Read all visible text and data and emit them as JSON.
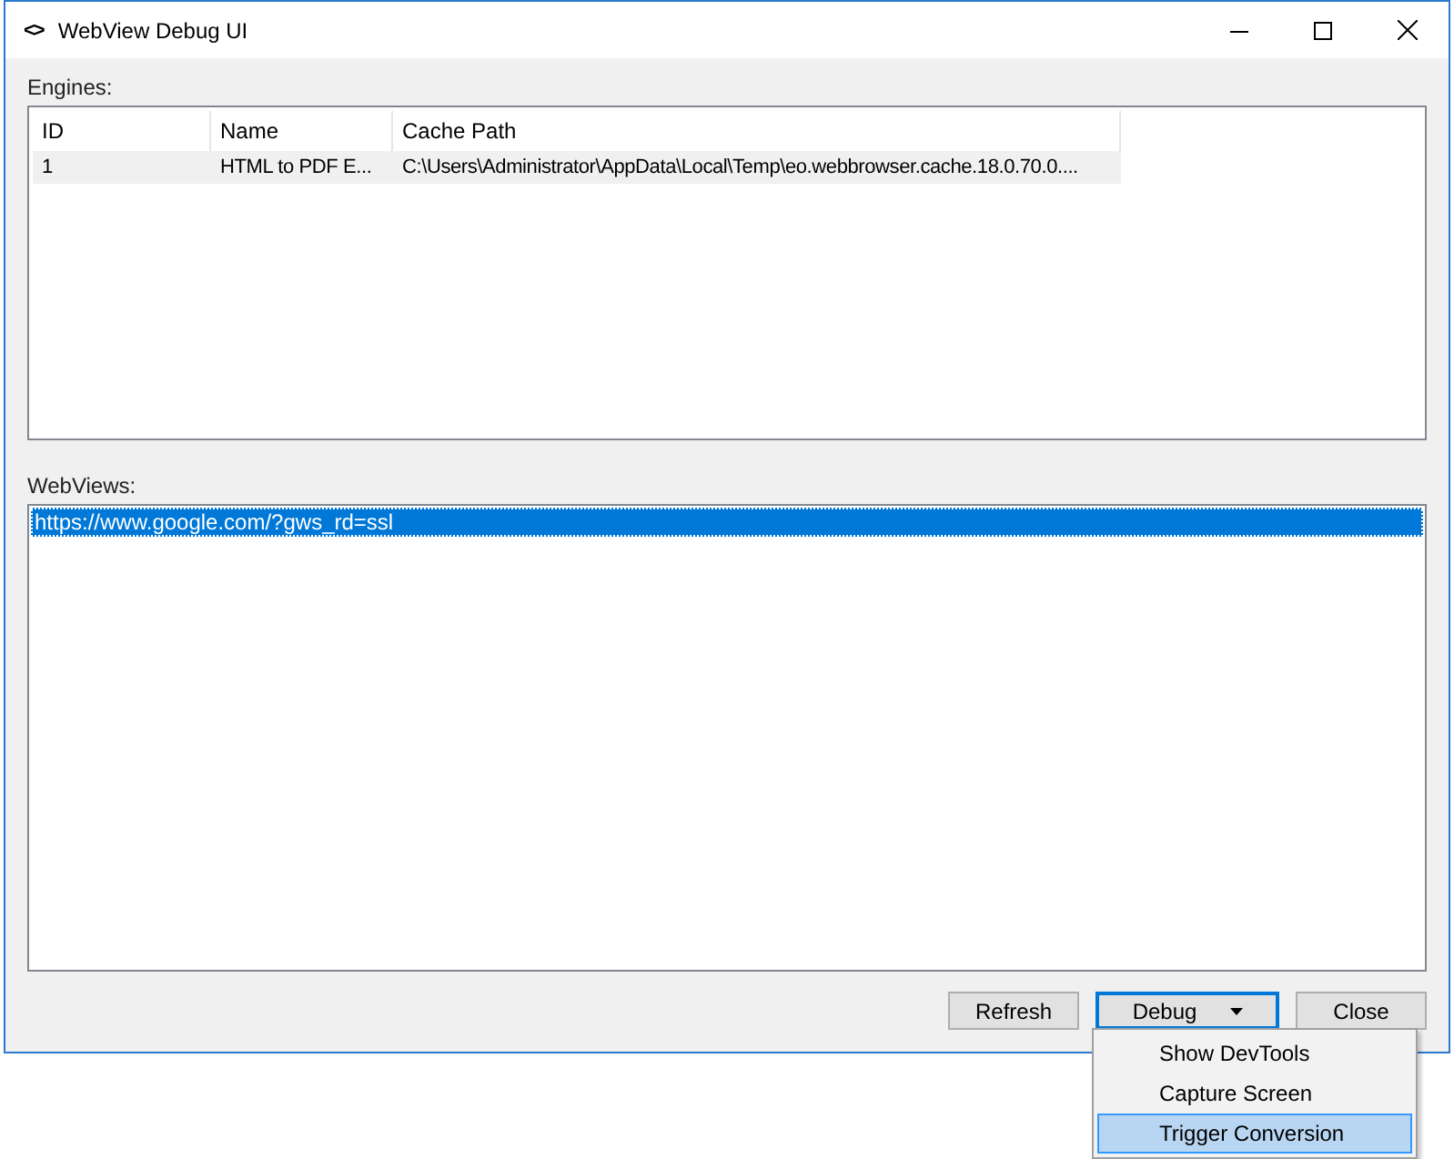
{
  "window": {
    "title": "WebView Debug UI",
    "icon": "<>"
  },
  "engines": {
    "label": "Engines:",
    "columns": [
      "ID",
      "Name",
      "Cache Path"
    ],
    "rows": [
      {
        "selected": true,
        "cells": [
          "1",
          "HTML to PDF E...",
          "C:\\Users\\Administrator\\AppData\\Local\\Temp\\eo.webbrowser.cache.18.0.70.0...."
        ]
      }
    ]
  },
  "webviews": {
    "label": "WebViews:",
    "items": [
      {
        "text": "https://www.google.com/?gws_rd=ssl",
        "selected": true
      }
    ]
  },
  "buttons": [
    {
      "label": "Refresh",
      "kind": "plain"
    },
    {
      "label": "Debug",
      "kind": "split",
      "focused": true
    },
    {
      "label": "Close",
      "kind": "plain"
    }
  ],
  "menu": {
    "items": [
      {
        "label": "Show DevTools",
        "selected": false
      },
      {
        "label": "Capture Screen",
        "selected": false
      },
      {
        "label": "Trigger Conversion",
        "selected": true
      }
    ]
  }
}
